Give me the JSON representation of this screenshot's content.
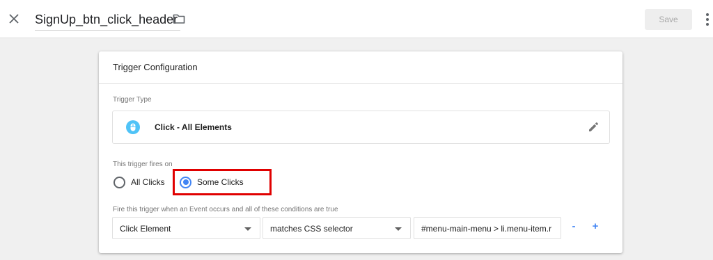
{
  "header": {
    "title": "SignUp_btn_click_header",
    "save_label": "Save"
  },
  "card": {
    "title": "Trigger Configuration",
    "trigger_type_label": "Trigger Type",
    "trigger_type_name": "Click - All Elements",
    "fires_on_label": "This trigger fires on",
    "fires_on_options": [
      "All Clicks",
      "Some Clicks"
    ],
    "fires_on_selected": "Some Clicks",
    "conditions_label": "Fire this trigger when an Event occurs and all of these conditions are true",
    "condition": {
      "variable": "Click Element",
      "operator": "matches CSS selector",
      "value": "#menu-main-menu > li.menu-item.r"
    },
    "minus_label": "-",
    "plus_label": "+"
  },
  "colors": {
    "accent": "#4285f4",
    "highlight": "#e00000",
    "trigger_icon_bg": "#4fc3f7"
  },
  "icons": [
    "close-icon",
    "folder-icon",
    "more-vert-icon",
    "mouse-icon",
    "pencil-icon",
    "dropdown-caret-icon"
  ]
}
